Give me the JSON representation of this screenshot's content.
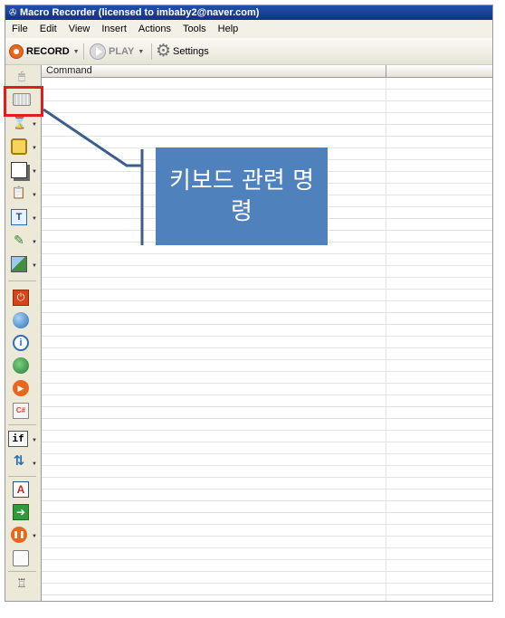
{
  "window": {
    "title": "Macro Recorder (licensed to imbaby2@naver.com)"
  },
  "menu": [
    "File",
    "Edit",
    "View",
    "Insert",
    "Actions",
    "Tools",
    "Help"
  ],
  "toolbar": {
    "record_label": "RECORD",
    "play_label": "PLAY",
    "settings_label": "Settings"
  },
  "grid": {
    "column_header": "Command"
  },
  "callout": {
    "text": "키보드 관련 명령"
  },
  "sidebar": {
    "icons": [
      "mouse-icon",
      "keyboard-icon",
      "hourglass-icon",
      "window-icon",
      "window-size-icon",
      "clipboard-icon",
      "text-icon",
      "color-picker-icon",
      "image-icon",
      "power-icon",
      "web-icon",
      "info-icon",
      "globe-icon",
      "play-icon",
      "script-icon",
      "if-icon",
      "loop-icon",
      "label-icon",
      "goto-icon",
      "pause-icon",
      "message-icon",
      "variable-icon"
    ],
    "if_label": "if"
  },
  "colors": {
    "titlebar": "#0f3388",
    "record": "#e9671c",
    "highlight": "#e31c1c",
    "callout": "#4f81bd",
    "leader": "#3b5f8a"
  }
}
